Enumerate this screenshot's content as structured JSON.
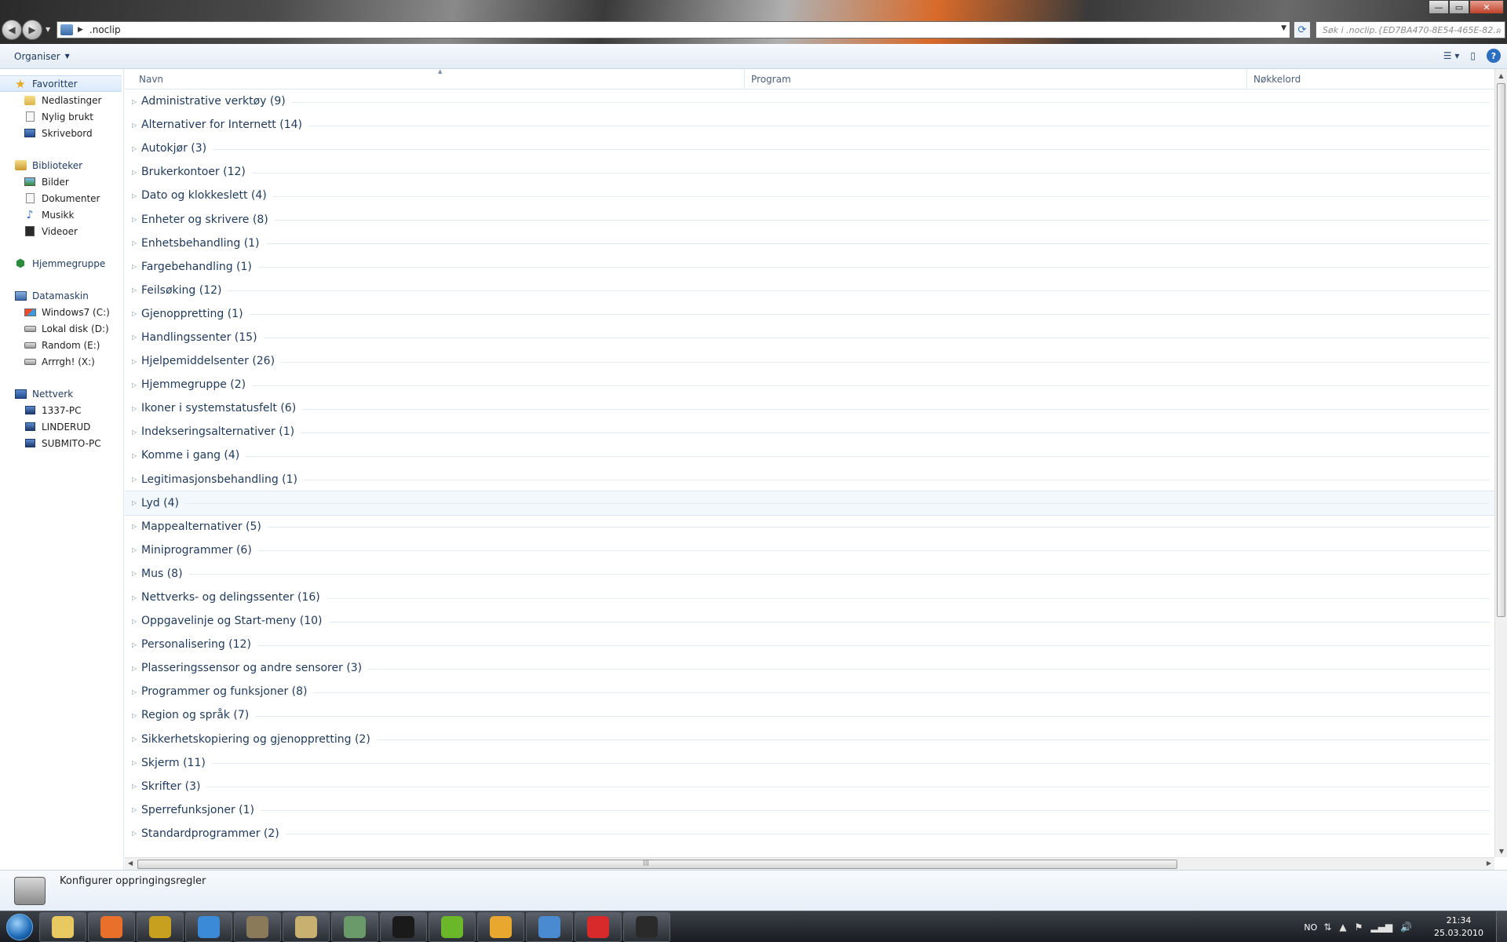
{
  "window": {
    "address": ".noclip",
    "search_placeholder": "Søk i .noclip.{ED7BA470-8E54-465E-82...",
    "minimize_glyph": "—",
    "maximize_glyph": "▭",
    "close_glyph": "✕"
  },
  "toolbar": {
    "organise_label": "Organiser"
  },
  "sidebar": {
    "favorites": {
      "label": "Favoritter",
      "items": [
        "Nedlastinger",
        "Nylig brukt",
        "Skrivebord"
      ]
    },
    "libraries": {
      "label": "Biblioteker",
      "items": [
        "Bilder",
        "Dokumenter",
        "Musikk",
        "Videoer"
      ]
    },
    "homegroup": {
      "label": "Hjemmegruppe"
    },
    "computer": {
      "label": "Datamaskin",
      "items": [
        "Windows7 (C:)",
        "Lokal disk (D:)",
        "Random (E:)",
        "Arrrgh! (X:)"
      ]
    },
    "network": {
      "label": "Nettverk",
      "items": [
        "1337-PC",
        "LINDERUD",
        "SUBMITO-PC"
      ]
    }
  },
  "columns": {
    "name": "Navn",
    "program": "Program",
    "keywords": "Nøkkelord"
  },
  "groups": [
    "Administrative verktøy (9)",
    "Alternativer for Internett (14)",
    "Autokjør (3)",
    "Brukerkontoer (12)",
    "Dato og klokkeslett (4)",
    "Enheter og skrivere (8)",
    "Enhetsbehandling (1)",
    "Fargebehandling (1)",
    "Feilsøking (12)",
    "Gjenoppretting (1)",
    "Handlingssenter (15)",
    "Hjelpemiddelsenter (26)",
    "Hjemmegruppe (2)",
    "Ikoner i systemstatusfelt (6)",
    "Indekseringsalternativer (1)",
    "Komme i gang (4)",
    "Legitimasjonsbehandling (1)",
    "Lyd (4)",
    "Mappealternativer (5)",
    "Miniprogrammer (6)",
    "Mus (8)",
    "Nettverks- og delingssenter (16)",
    "Oppgavelinje og Start-meny (10)",
    "Personalisering (12)",
    "Plasseringssensor og andre sensorer (3)",
    "Programmer og funksjoner (8)",
    "Region og språk (7)",
    "Sikkerhetskopiering og gjenoppretting (2)",
    "Skjerm (11)",
    "Skrifter (3)",
    "Sperrefunksjoner (1)",
    "Standardprogrammer (2)"
  ],
  "highlighted_group": "Lyd (4)",
  "details": {
    "text": "Konfigurer oppringingsregler"
  },
  "taskbar": {
    "apps": [
      {
        "name": "explorer",
        "color": "#e8c860"
      },
      {
        "name": "firefox",
        "color": "#e8702a"
      },
      {
        "name": "winamp",
        "color": "#c8a020"
      },
      {
        "name": "messenger",
        "color": "#3a8ad8"
      },
      {
        "name": "media",
        "color": "#8a7a5a"
      },
      {
        "name": "notes",
        "color": "#c8b070"
      },
      {
        "name": "gem",
        "color": "#6a9a6a"
      },
      {
        "name": "steam",
        "color": "#1a1a1a"
      },
      {
        "name": "spotify",
        "color": "#6ab82a"
      },
      {
        "name": "settings",
        "color": "#e8a830"
      },
      {
        "name": "users",
        "color": "#4a8ad0"
      },
      {
        "name": "avira",
        "color": "#d82a2a"
      },
      {
        "name": "game",
        "color": "#2a2a2a"
      }
    ],
    "language": "NO",
    "time": "21:34",
    "date": "25.03.2010"
  }
}
